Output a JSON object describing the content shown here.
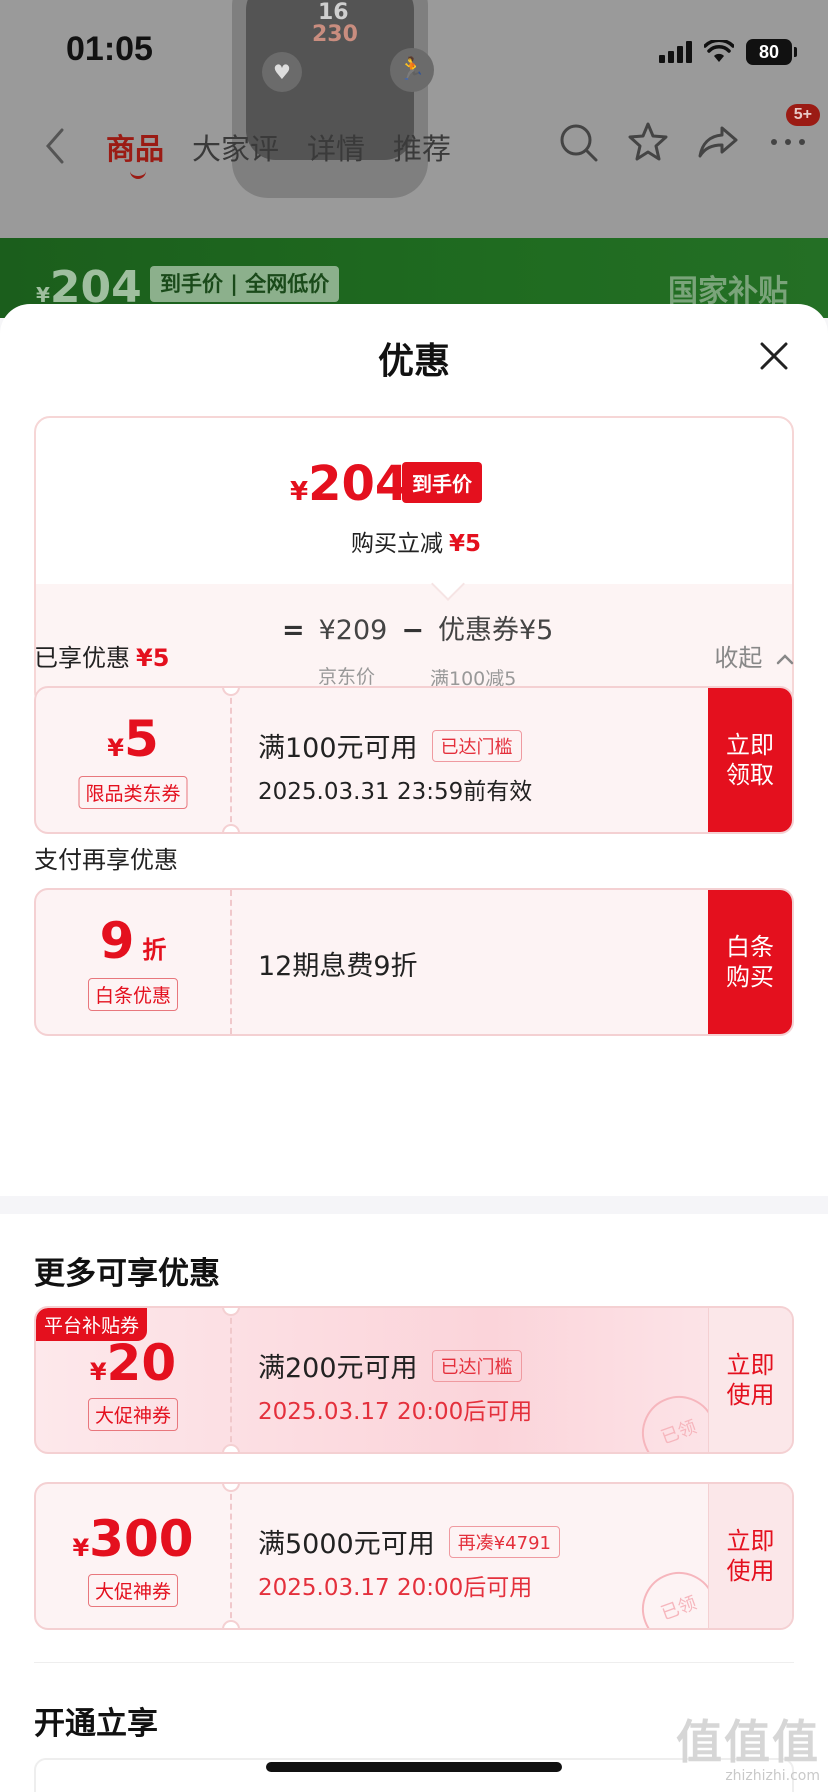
{
  "status_bar": {
    "time": "01:05",
    "battery": "80"
  },
  "product_bg": {
    "watch_top_num": "16",
    "watch_bottom_num": "230"
  },
  "nav": {
    "tabs": [
      "商品",
      "大家评",
      "详情",
      "推荐"
    ],
    "active_tab": "商品",
    "more_badge": "5+"
  },
  "green_banner": {
    "currency": "¥",
    "price": "204",
    "tag": "到手价 | 全网低价",
    "right_text": "国家补贴"
  },
  "sheet": {
    "title": "优惠",
    "summary": {
      "currency": "¥",
      "final_price": "204",
      "final_tag": "到手价",
      "instant_cut_label": "购买立减",
      "instant_cut_amount": "¥5",
      "eq": "=",
      "jd_price": "¥209",
      "minus": "−",
      "coupon_part": "优惠券¥5",
      "jd_price_label": "京东价",
      "coupon_rule": "满100减5"
    },
    "enjoyed": {
      "label": "已享优惠",
      "amount": "¥5",
      "collapse": "收起"
    },
    "coupon1": {
      "currency": "¥",
      "amount": "5",
      "label": "限品类东券",
      "title": "满100元可用",
      "chip": "已达门槛",
      "date": "2025.03.31 23:59前有效",
      "action": "立即领取"
    },
    "pay_section": {
      "label": "支付再享优惠"
    },
    "coupon2": {
      "amount": "9",
      "unit": "折",
      "label": "白条优惠",
      "title": "12期息费9折",
      "action": "白条购买"
    },
    "more_section": {
      "title": "更多可享优惠"
    },
    "coupon3": {
      "corner": "平台补贴券",
      "currency": "¥",
      "amount": "20",
      "label": "大促神券",
      "title": "满200元可用",
      "chip": "已达门槛",
      "date": "2025.03.17 20:00后可用",
      "action": "立即使用",
      "stamp": "已领"
    },
    "coupon4": {
      "currency": "¥",
      "amount": "300",
      "label": "大促神券",
      "title": "满5000元可用",
      "chip": "再凑¥4791",
      "date": "2025.03.17 20:00后可用",
      "action": "立即使用",
      "stamp": "已领"
    },
    "open_section": {
      "title": "开通立享"
    }
  },
  "watermark": {
    "big": "值值值",
    "small": "zhizhizhi.com"
  },
  "colors": {
    "accent": "#e4101e",
    "sheet_bg": "#ffffff",
    "green": "#1f6b20"
  },
  "icons": [
    "back-icon",
    "search-icon",
    "star-icon",
    "share-icon",
    "more-icon",
    "close-icon",
    "chevron-up-icon"
  ]
}
